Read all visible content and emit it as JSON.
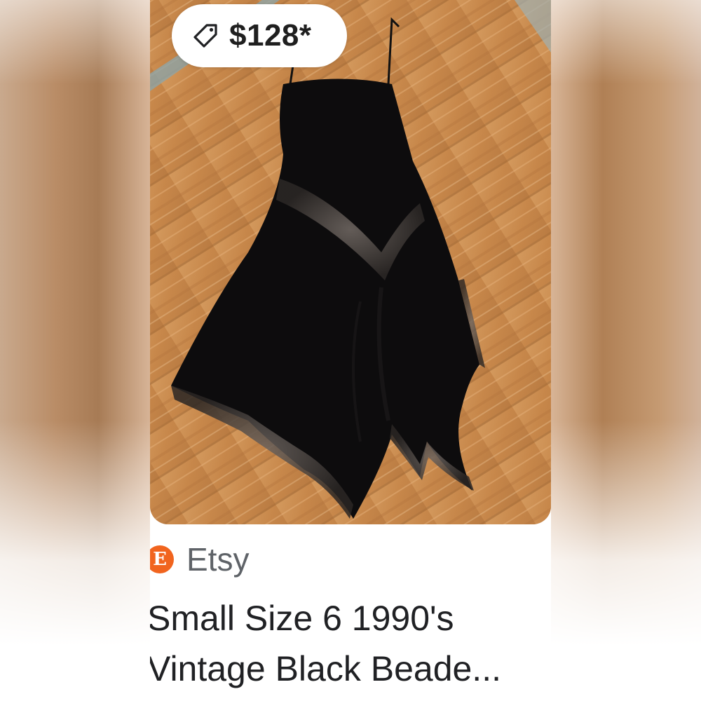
{
  "result_card": {
    "price": "$128*",
    "price_icon": "price-tag-icon",
    "source": {
      "icon": "etsy-icon",
      "icon_letter": "E",
      "name": "Etsy",
      "color": "#f1641e"
    },
    "title_lines": [
      "Small Size 6 1990's",
      "Vintage Black Beade..."
    ],
    "image_alt": "black beaded handkerchief-hem slip dress on wooden floor"
  }
}
